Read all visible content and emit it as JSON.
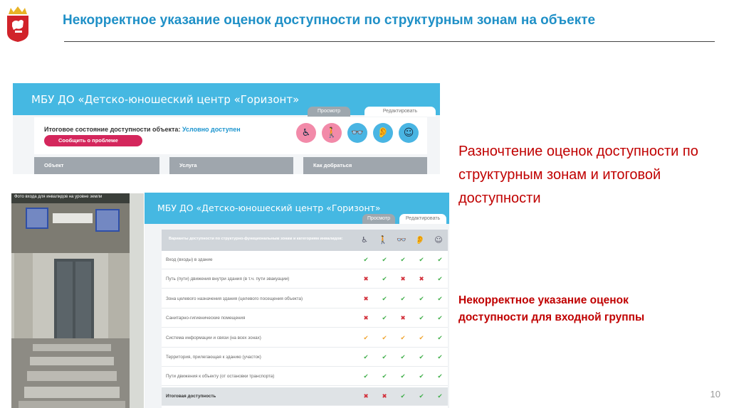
{
  "slide": {
    "title": "Некорректное указание оценок доступности по структурным зонам на объекте",
    "page_number": "10"
  },
  "captions": {
    "discrepancy": "Разночтение оценок доступности по структурным зонам и итоговой доступности",
    "incorrect_entry": "Некорректное указание оценок доступности для входной группы"
  },
  "shot1": {
    "org_name": "МБУ ДО «Детско-юношеский центр «Горизонт»",
    "tab_view": "Просмотр",
    "tab_edit": "Редактировать",
    "status_label": "Итоговое состояние доступности объекта:",
    "status_value": "Условно доступен",
    "report_button": "Сообщить о проблеме",
    "columns": [
      "Объект",
      "Услуга",
      "Как добраться"
    ],
    "icons": [
      {
        "name": "wheelchair",
        "glyph": "♿",
        "color": "#f28aa9"
      },
      {
        "name": "mobility",
        "glyph": "🚶",
        "color": "#f28aa9"
      },
      {
        "name": "vision",
        "glyph": "👓",
        "color": "#49b5e3"
      },
      {
        "name": "hearing",
        "glyph": "👂",
        "color": "#49b5e3"
      },
      {
        "name": "mental",
        "glyph": "☺",
        "color": "#49b5e3"
      }
    ]
  },
  "photo": {
    "caption": "Фото входа для инвалидов на уровне земли"
  },
  "shot2": {
    "org_name": "МБУ ДО «Детско-юношеский центр «Горизонт»",
    "tab_view": "Просмотр",
    "tab_edit": "Редактировать",
    "table_header": "Варианты доступности по структурно-функциональным зонам и категориям инвалидов:",
    "header_icons": [
      "♿",
      "🚶",
      "👓",
      "👂",
      "☺"
    ],
    "rows": [
      {
        "label": "Вход (входы) в здание",
        "marks": [
          "ok",
          "ok",
          "ok",
          "ok",
          "ok"
        ]
      },
      {
        "label": "Путь (пути) движения внутри здания (в т.ч. пути эвакуации)",
        "marks": [
          "no",
          "ok",
          "no",
          "no",
          "ok"
        ]
      },
      {
        "label": "Зона целевого назначения здания (целевого посещения объекта)",
        "marks": [
          "no",
          "ok",
          "ok",
          "ok",
          "ok"
        ]
      },
      {
        "label": "Санитарно-гигиенические помещения",
        "marks": [
          "no",
          "ok",
          "no",
          "ok",
          "ok"
        ]
      },
      {
        "label": "Система информации и связи (на всех зонах)",
        "marks": [
          "warn",
          "warn",
          "warn",
          "warn",
          "ok"
        ]
      },
      {
        "label": "Территория, прилегающая к зданию (участок)",
        "marks": [
          "ok",
          "ok",
          "ok",
          "ok",
          "ok"
        ]
      },
      {
        "label": "Пути движения к объекту (от остановки транспорта)",
        "marks": [
          "ok",
          "ok",
          "ok",
          "ok",
          "ok"
        ]
      },
      {
        "label": "Итоговая доступность",
        "marks": [
          "no",
          "no",
          "ok",
          "ok",
          "ok"
        ],
        "total": true
      }
    ],
    "mark_colors": {
      "ok": "#3fae49",
      "no": "#d22f3a",
      "warn": "#f0a22b"
    },
    "mark_glyphs": {
      "ok": "✔",
      "no": "✖",
      "warn": "✔"
    }
  }
}
